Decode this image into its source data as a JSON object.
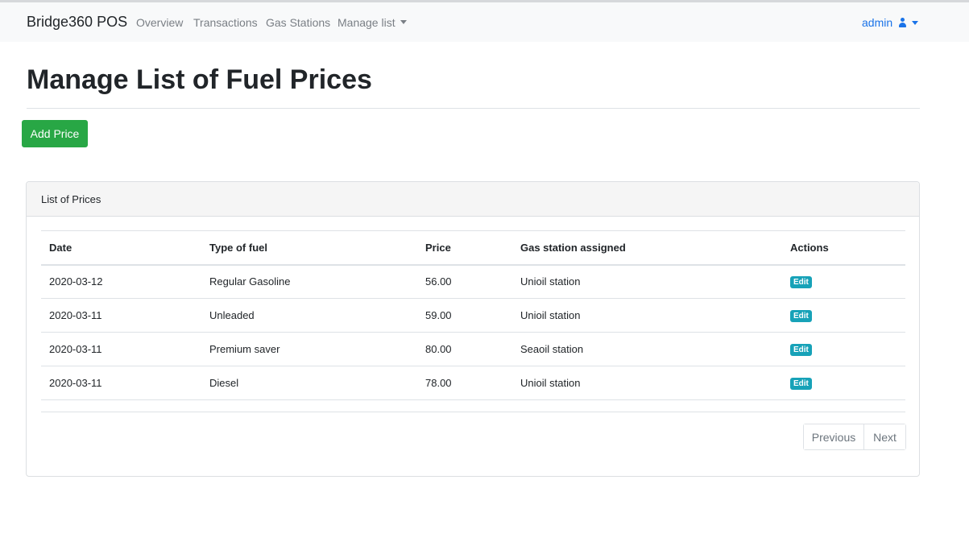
{
  "navbar": {
    "brand": "Bridge360 POS",
    "links": [
      "Overview",
      "Transactions",
      "Gas Stations",
      "Manage list"
    ],
    "user": "admin"
  },
  "page": {
    "title": "Manage List of Fuel Prices",
    "add_button": "Add Price"
  },
  "card": {
    "header": "List of Prices",
    "columns": [
      "Date",
      "Type of fuel",
      "Price",
      "Gas station assigned",
      "Actions"
    ],
    "rows": [
      {
        "date": "2020-03-12",
        "fuel": "Regular Gasoline",
        "price": "56.00",
        "station": "Unioil station",
        "action": "Edit"
      },
      {
        "date": "2020-03-11",
        "fuel": "Unleaded",
        "price": "59.00",
        "station": "Unioil station",
        "action": "Edit"
      },
      {
        "date": "2020-03-11",
        "fuel": "Premium saver",
        "price": "80.00",
        "station": "Seaoil station",
        "action": "Edit"
      },
      {
        "date": "2020-03-11",
        "fuel": "Diesel",
        "price": "78.00",
        "station": "Unioil station",
        "action": "Edit"
      }
    ],
    "pagination": {
      "previous": "Previous",
      "next": "Next"
    }
  },
  "colors": {
    "primary": "#1a73e8",
    "success": "#28a745",
    "info": "#17a2b8"
  }
}
